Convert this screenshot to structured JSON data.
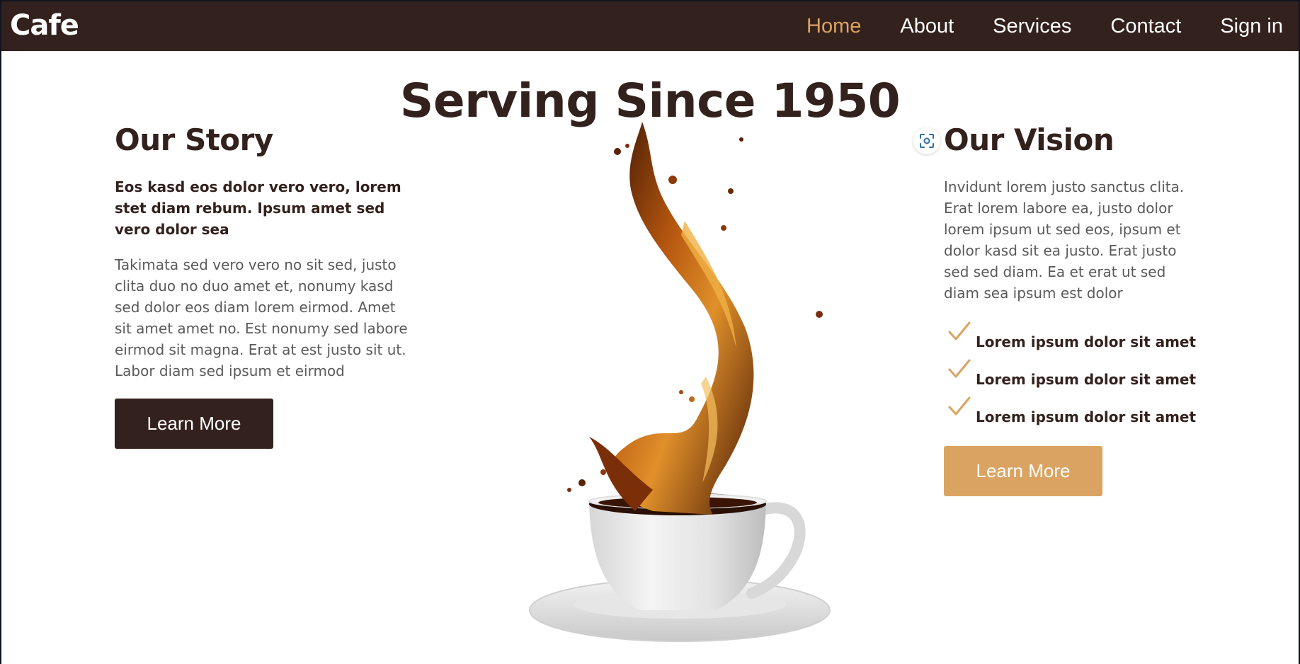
{
  "navbar": {
    "brand": "Cafe",
    "links": [
      {
        "label": "Home",
        "active": true
      },
      {
        "label": "About"
      },
      {
        "label": "Services"
      },
      {
        "label": "Contact"
      },
      {
        "label": "Sign in"
      }
    ]
  },
  "hero": {
    "title": "Serving Since 1950"
  },
  "story": {
    "heading": "Our Story",
    "lead": "Eos kasd eos dolor vero vero, lorem stet diam rebum. Ipsum amet sed vero dolor sea",
    "body": "Takimata sed vero vero no sit sed, justo clita duo no duo amet et, nonumy kasd sed dolor eos diam lorem eirmod. Amet sit amet amet no. Est nonumy sed labore eirmod sit magna. Erat at est justo sit ut. Labor diam sed ipsum et eirmod",
    "button": "Learn More"
  },
  "vision": {
    "heading": "Our Vision",
    "body": "Invidunt lorem justo sanctus clita. Erat lorem labore ea, justo dolor lorem ipsum ut sed eos, ipsum et dolor kasd sit ea justo. Erat justo sed sed diam. Ea et erat ut sed diam sea ipsum est dolor",
    "checklist": [
      "Lorem ipsum dolor sit amet",
      "Lorem ipsum dolor sit amet",
      "Lorem ipsum dolor sit amet"
    ],
    "button": "Learn More"
  },
  "colors": {
    "brown": "#33211d",
    "gold": "#dba361",
    "text_muted": "#5a5a5a"
  },
  "icons": {
    "lens": "screen-capture-icon",
    "check": "checkmark-icon"
  }
}
